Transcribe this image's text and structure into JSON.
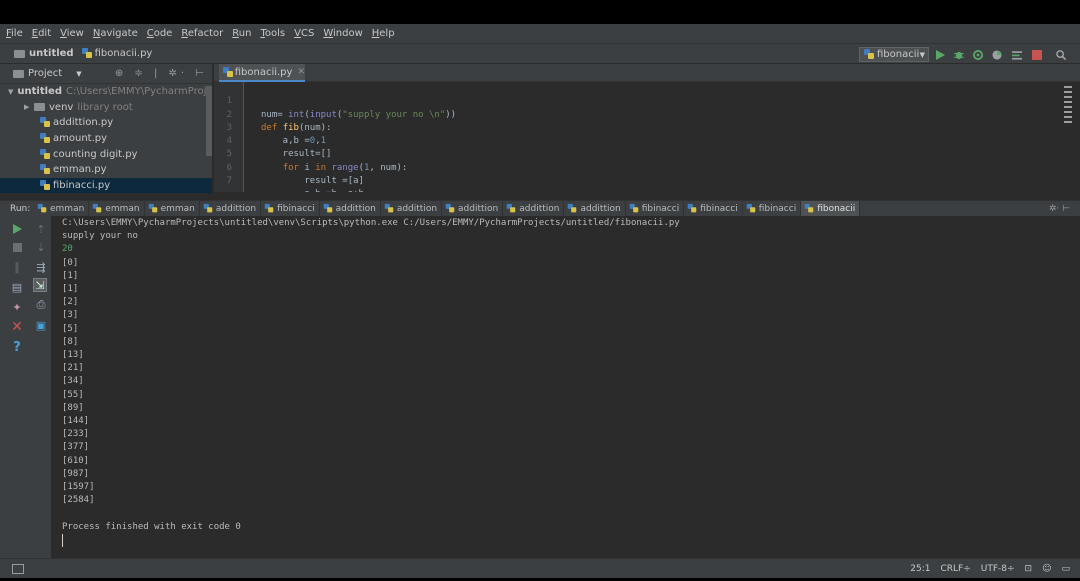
{
  "menu": [
    "File",
    "Edit",
    "View",
    "Navigate",
    "Code",
    "Refactor",
    "Run",
    "Tools",
    "VCS",
    "Window",
    "Help"
  ],
  "navbar": {
    "project": "untitled",
    "file": "fibonacii.py",
    "run_config": "fibonacii"
  },
  "project_panel": {
    "title": "Project",
    "root_name": "untitled",
    "root_path": "C:\\Users\\EMMY\\PycharmProjects\\untitled",
    "items": [
      {
        "label": "venv",
        "suffix": "library root",
        "type": "folder"
      },
      {
        "label": "addittion.py",
        "type": "file"
      },
      {
        "label": "amount.py",
        "type": "file"
      },
      {
        "label": "counting digit.py",
        "type": "file"
      },
      {
        "label": "emman.py",
        "type": "file"
      },
      {
        "label": "fibinacci.py",
        "type": "file",
        "selected": true
      }
    ]
  },
  "editor": {
    "tab_label": "fibonacii.py",
    "line_numbers": [
      "1",
      "2",
      "3",
      "4",
      "5",
      "6",
      "7"
    ]
  },
  "run_window": {
    "label": "Run:",
    "tabs": [
      "emman",
      "emman",
      "emman",
      "addittion",
      "fibinacci",
      "addittion",
      "addittion",
      "addittion",
      "addittion",
      "addittion",
      "fibinacci",
      "fibinacci",
      "fibinacci",
      "fibonacii"
    ],
    "active_tab_index": 13
  },
  "console": {
    "command": "C:\\Users\\EMMY\\PycharmProjects\\untitled\\venv\\Scripts\\python.exe C:/Users/EMMY/PycharmProjects/untitled/fibonacii.py",
    "prompt": "supply your no",
    "input": "20",
    "output": [
      "[0]",
      "[1]",
      "[1]",
      "[2]",
      "[3]",
      "[5]",
      "[8]",
      "[13]",
      "[21]",
      "[34]",
      "[55]",
      "[89]",
      "[144]",
      "[233]",
      "[377]",
      "[610]",
      "[987]",
      "[1597]",
      "[2584]"
    ],
    "exit_message": "Process finished with exit code 0"
  },
  "statusbar": {
    "position": "25:1",
    "line_sep": "CRLF",
    "encoding": "UTF-8"
  },
  "colors": {
    "background": "#2b2b2b",
    "panel": "#3c3f41",
    "keyword": "#cc7832",
    "string": "#6a8759",
    "number": "#6897bb",
    "run_green": "#59a869",
    "stop_red": "#c75450"
  },
  "icons": [
    "folder-icon",
    "python-file-icon",
    "play-icon",
    "debug-icon",
    "stop-icon",
    "rerun-icon",
    "search-icon",
    "gear-icon",
    "close-icon",
    "help-icon",
    "trash-icon",
    "print-icon",
    "pin-icon"
  ]
}
